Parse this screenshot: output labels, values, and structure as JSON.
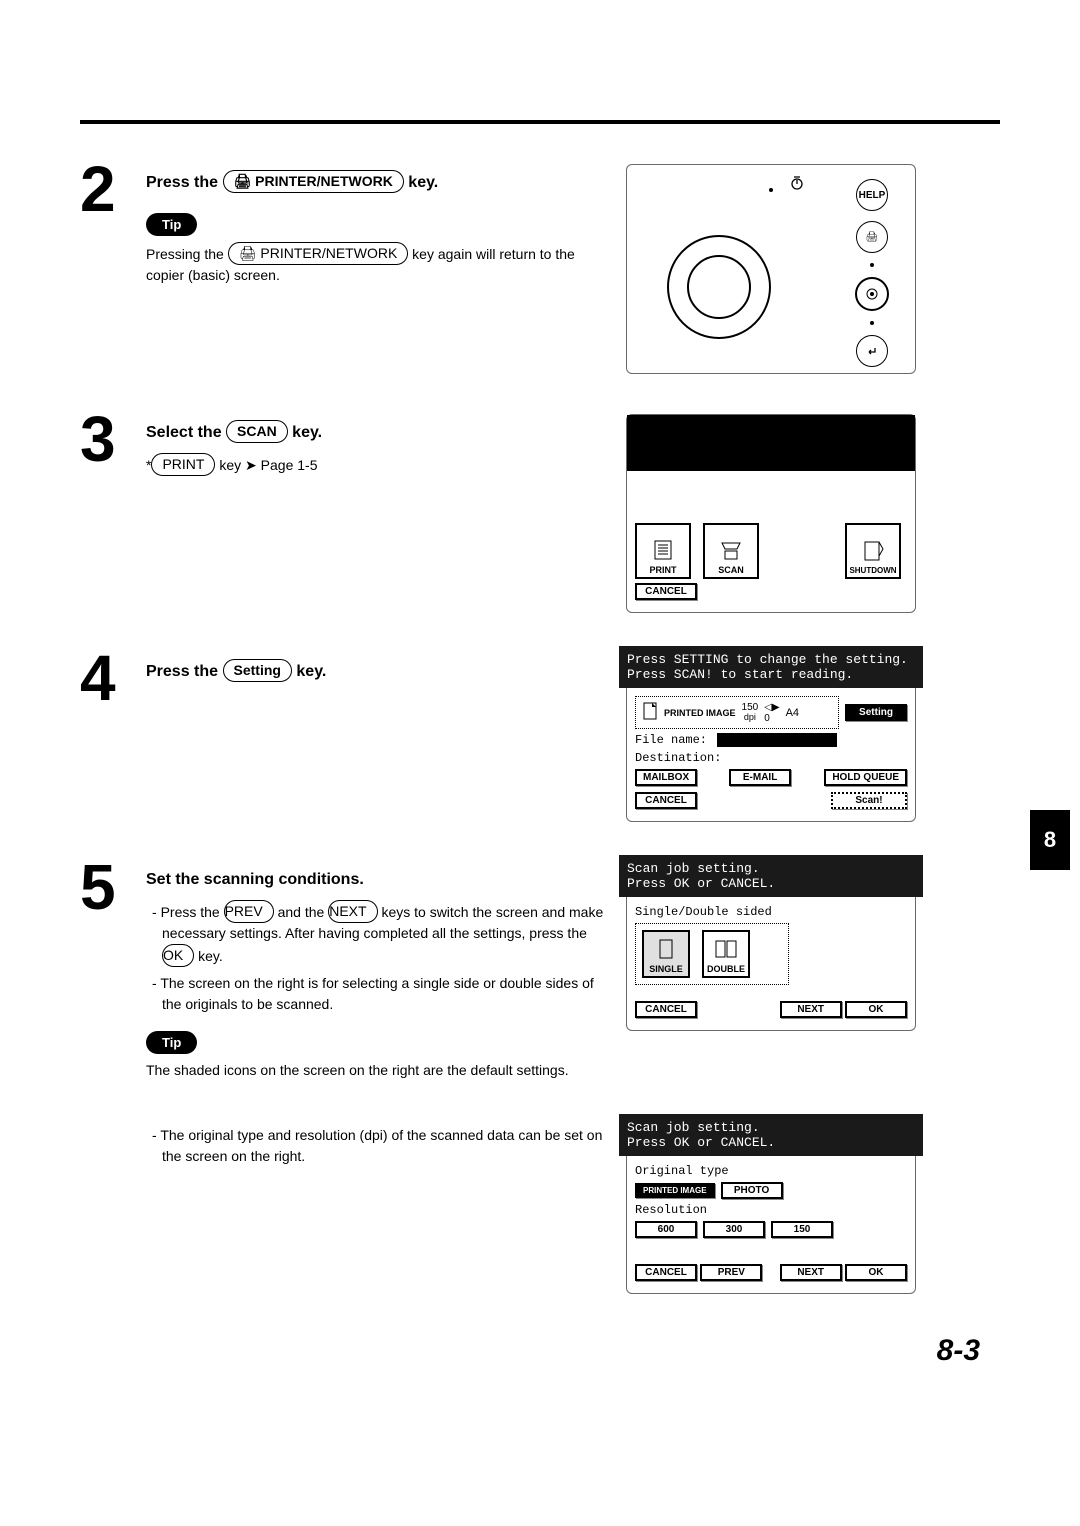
{
  "top_rule": true,
  "steps": {
    "s2": {
      "num": "2",
      "heading_prefix": "Press the",
      "heading_key_icon": "printer-icon",
      "heading_key": "PRINTER/NETWORK",
      "heading_suffix": "key.",
      "tip_label": "Tip",
      "tip_body_a": "Pressing the",
      "tip_body_key": "PRINTER/NETWORK",
      "tip_body_b": "key again will return to the copier (basic) screen."
    },
    "s3": {
      "num": "3",
      "heading_prefix": "Select the",
      "heading_key": "SCAN",
      "heading_suffix": "key.",
      "sub_star": "*",
      "sub_key": "PRINT",
      "sub_text_a": "key",
      "sub_text_b": "Page 1-5",
      "panel": {
        "btn_print": "PRINT",
        "btn_scan": "SCAN",
        "btn_shutdown": "SHUTDOWN",
        "btn_cancel": "CANCEL"
      }
    },
    "s4": {
      "num": "4",
      "heading_prefix": "Press the",
      "heading_key": "Setting",
      "heading_suffix": "key.",
      "panel": {
        "line1": "Press SETTING to change the setting.",
        "line2": "Press SCAN! to start reading.",
        "info_label": "PRINTED IMAGE",
        "info_dpi_num": "150",
        "info_dpi_unit": "dpi",
        "info_rot": "0",
        "info_paper": "A4",
        "btn_setting": "Setting",
        "file_name_label": "File name:",
        "destination_label": "Destination:",
        "btn_mailbox": "MAILBOX",
        "btn_email": "E-MAIL",
        "btn_holdqueue": "HOLD QUEUE",
        "btn_cancel": "CANCEL",
        "btn_scan": "Scan!"
      }
    },
    "s5": {
      "num": "5",
      "heading": "Set the scanning conditions.",
      "bullet1_a": "Press the",
      "bullet1_k1": "PREV",
      "bullet1_b": "and the",
      "bullet1_k2": "NEXT",
      "bullet1_c": "keys to switch the screen and make necessary settings.  After having completed all the settings, press the",
      "bullet1_k3": "OK",
      "bullet1_d": "key.",
      "bullet2": "The screen on the right is for selecting a single side or double sides of the originals to be scanned.",
      "tip_label": "Tip",
      "tip_body": "The shaded icons on the screen on the right are the default settings.",
      "bullet3": "The original type and resolution (dpi) of the scanned data can be set on the screen on the right.",
      "panel_a": {
        "line1": "Scan job setting.",
        "line2": "Press OK or CANCEL.",
        "sect": "Single/Double sided",
        "btn_single": "SINGLE",
        "btn_double": "DOUBLE",
        "btn_cancel": "CANCEL",
        "btn_next": "NEXT",
        "btn_ok": "OK"
      },
      "panel_b": {
        "line1": "Scan job setting.",
        "line2": "Press OK or CANCEL.",
        "sect1": "Original type",
        "btn_printed": "PRINTED IMAGE",
        "btn_photo": "PHOTO",
        "sect2": "Resolution",
        "btn_600": "600",
        "btn_300": "300",
        "btn_150": "150",
        "btn_cancel": "CANCEL",
        "btn_prev": "PREV",
        "btn_next": "NEXT",
        "btn_ok": "OK"
      }
    }
  },
  "side_tab": "8",
  "page_number": "8-3",
  "ctrl_labels": {
    "help": "HELP"
  }
}
